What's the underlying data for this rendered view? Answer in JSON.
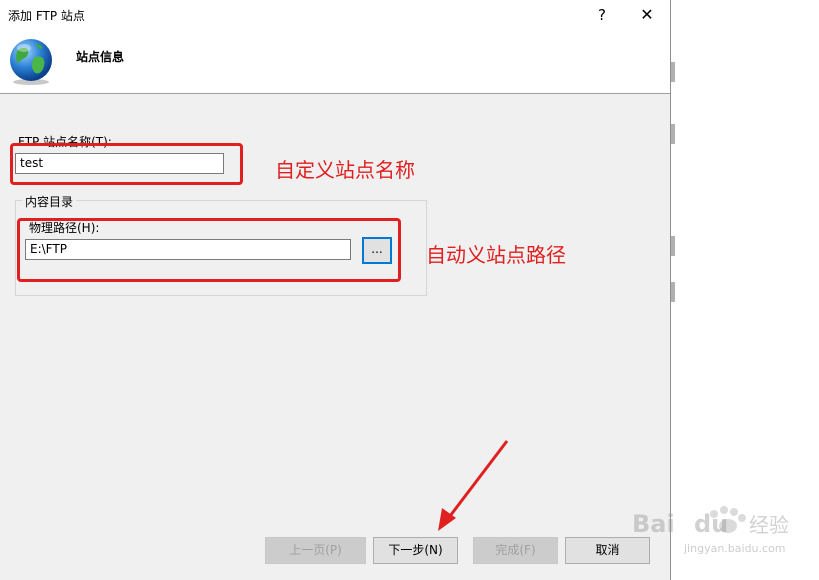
{
  "window": {
    "title": "添加 FTP 站点",
    "help_glyph": "?",
    "close_glyph": "✕"
  },
  "header": {
    "title": "站点信息",
    "icon": "globe-icon"
  },
  "form": {
    "site_name_label": "FTP 站点名称(T):",
    "site_name_value": "test",
    "content_group_title": "内容目录",
    "path_label": "物理路径(H):",
    "path_value": "E:\\FTP",
    "browse_label": "..."
  },
  "annotations": {
    "site_name_note": "自定义站点名称",
    "path_note": "自动义站点路径",
    "color": "#e02020"
  },
  "buttons": {
    "prev": "上一页(P)",
    "next": "下一步(N)",
    "finish": "完成(F)",
    "cancel": "取消"
  },
  "watermark": {
    "brand_left": "Bai",
    "brand_right": "du",
    "brand_cn": "经验",
    "url": "jingyan.baidu.com"
  }
}
